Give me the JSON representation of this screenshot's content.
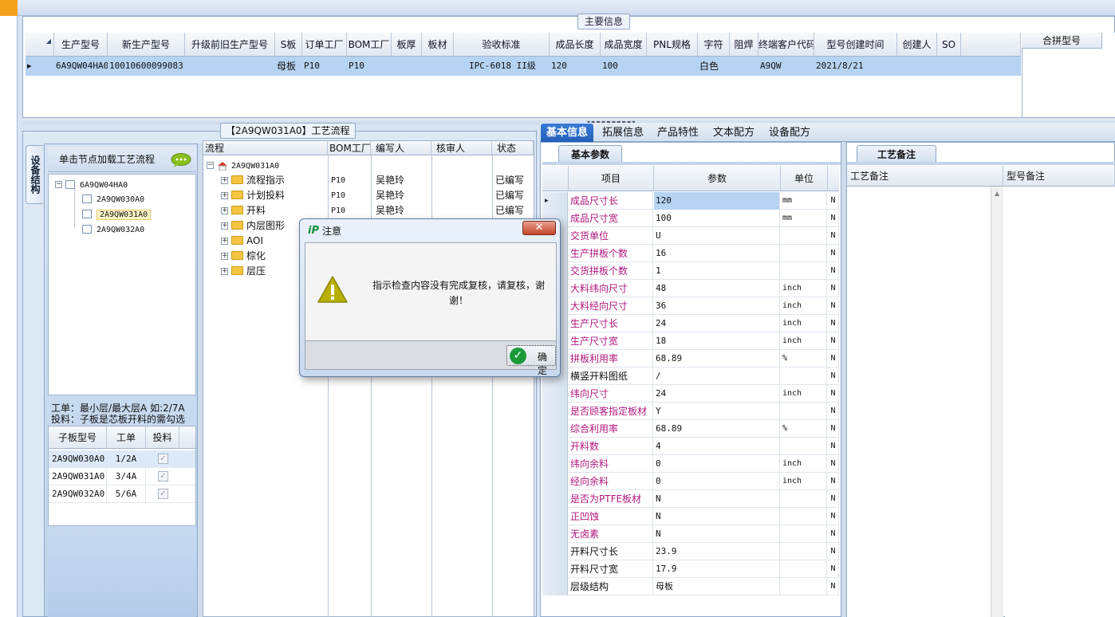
{
  "main_info": {
    "title": "主要信息",
    "columns": [
      "生产型号",
      "新生产型号",
      "升级前旧生产型号",
      "S板",
      "订单工厂",
      "BOM工厂",
      "板厚",
      "板材",
      "验收标准",
      "成品长度",
      "成品宽度",
      "PNL规格",
      "字符",
      "阻焊",
      "终端客户代码",
      "型号创建时间",
      "创建人",
      "SO"
    ],
    "row": [
      "6A9QW04HA0",
      "10010600099083",
      "",
      "母板",
      "P10",
      "P10",
      "",
      "",
      "IPC-6018 II级",
      "120",
      "100",
      "",
      "白色",
      "",
      "A9QW",
      "2021/8/21",
      "",
      ""
    ],
    "merge_header": "合拼型号"
  },
  "process": {
    "title": "【2A9QW031A0】工艺流程",
    "vertical_tab": "设备结构",
    "click_hint": "单击节点加载工艺流程",
    "left_tree": {
      "root": "6A9QW04HA0",
      "children": [
        "2A9QW030A0",
        "2A9QW031A0",
        "2A9QW032A0"
      ]
    },
    "info_line1": "工单：最小层/最大层A 如:2/7A",
    "info_line2": "投料：子板是芯板开料的需勾选",
    "sub_table": {
      "columns": [
        "子板型号",
        "工单",
        "投料"
      ],
      "rows": [
        [
          "2A9QW030A0",
          "1/2A"
        ],
        [
          "2A9QW031A0",
          "3/4A"
        ],
        [
          "2A9QW032A0",
          "5/6A"
        ]
      ]
    },
    "tree_columns": [
      "流程",
      "BOM工厂",
      "编写人",
      "核审人",
      "状态"
    ],
    "tree_root": "2A9QW031A0",
    "tree_rows": [
      {
        "name": "流程指示",
        "bom": "P10",
        "writer": "吴艳玲",
        "status": "已编写"
      },
      {
        "name": "计划投料",
        "bom": "P10",
        "writer": "吴艳玲",
        "status": "已编写"
      },
      {
        "name": "开料",
        "bom": "P10",
        "writer": "吴艳玲",
        "status": "已编写"
      },
      {
        "name": "内层图形",
        "bom": "",
        "writer": "",
        "status": ""
      },
      {
        "name": "AOI",
        "bom": "",
        "writer": "",
        "status": ""
      },
      {
        "name": "棕化",
        "bom": "",
        "writer": "",
        "status": ""
      },
      {
        "name": "层压",
        "bom": "",
        "writer": "",
        "status": ""
      }
    ]
  },
  "right_tabs": [
    "基本信息",
    "拓展信息",
    "产品特性",
    "文本配方",
    "设备配方"
  ],
  "basic_params": {
    "tab": "基本参数",
    "columns": [
      "项目",
      "参数",
      "单位"
    ],
    "rows": [
      {
        "name": "成品尺寸长",
        "value": "120",
        "unit": "mm",
        "flag": "N",
        "hl": true
      },
      {
        "name": "成品尺寸宽",
        "value": "100",
        "unit": "mm",
        "flag": "N",
        "hl": true
      },
      {
        "name": "交货单位",
        "value": "U",
        "unit": "",
        "flag": "N",
        "hl": true
      },
      {
        "name": "生产拼板个数",
        "value": "16",
        "unit": "",
        "flag": "N",
        "hl": true
      },
      {
        "name": "交货拼板个数",
        "value": "1",
        "unit": "",
        "flag": "N",
        "hl": true
      },
      {
        "name": "大料纬向尺寸",
        "value": "48",
        "unit": "inch",
        "flag": "N",
        "hl": true
      },
      {
        "name": "大料经向尺寸",
        "value": "36",
        "unit": "inch",
        "flag": "N",
        "hl": true
      },
      {
        "name": "生产尺寸长",
        "value": "24",
        "unit": "inch",
        "flag": "N",
        "hl": true
      },
      {
        "name": "生产尺寸宽",
        "value": "18",
        "unit": "inch",
        "flag": "N",
        "hl": true
      },
      {
        "name": "拼板利用率",
        "value": "68.89",
        "unit": "%",
        "flag": "N",
        "hl": true
      },
      {
        "name": "横竖开料图纸",
        "value": "/",
        "unit": "",
        "flag": "N",
        "hl": false
      },
      {
        "name": "纬向尺寸",
        "value": "24",
        "unit": "inch",
        "flag": "N",
        "hl": true
      },
      {
        "name": "是否顾客指定板材",
        "value": "Y",
        "unit": "",
        "flag": "N",
        "hl": true
      },
      {
        "name": "综合利用率",
        "value": "68.89",
        "unit": "%",
        "flag": "N",
        "hl": true
      },
      {
        "name": "开料数",
        "value": "4",
        "unit": "",
        "flag": "N",
        "hl": true
      },
      {
        "name": "纬向余料",
        "value": "0",
        "unit": "inch",
        "flag": "N",
        "hl": true
      },
      {
        "name": "经向余料",
        "value": "0",
        "unit": "inch",
        "flag": "N",
        "hl": true
      },
      {
        "name": "是否为PTFE板材",
        "value": "N",
        "unit": "",
        "flag": "N",
        "hl": true
      },
      {
        "name": "正凹蚀",
        "value": "N",
        "unit": "",
        "flag": "N",
        "hl": true
      },
      {
        "name": "无卤素",
        "value": "N",
        "unit": "",
        "flag": "N",
        "hl": true
      },
      {
        "name": "开料尺寸长",
        "value": "23.9",
        "unit": "",
        "flag": "N",
        "hl": false
      },
      {
        "name": "开料尺寸宽",
        "value": "17.9",
        "unit": "",
        "flag": "N",
        "hl": false
      },
      {
        "name": "层级结构",
        "value": "母板",
        "unit": "",
        "flag": "N",
        "hl": false
      }
    ]
  },
  "remarks": {
    "tab": "工艺备注",
    "columns": [
      "工艺备注",
      "型号备注"
    ]
  },
  "dialog": {
    "title": "注意",
    "message": "指示检查内容没有完成复核，请复核，谢谢！",
    "ok": "确定",
    "close": "✕"
  },
  "colors": {
    "accent": "#215fb8",
    "selection": "#b7d3f2",
    "highlight_text": "#b0177d",
    "warning": "#b8b000"
  }
}
